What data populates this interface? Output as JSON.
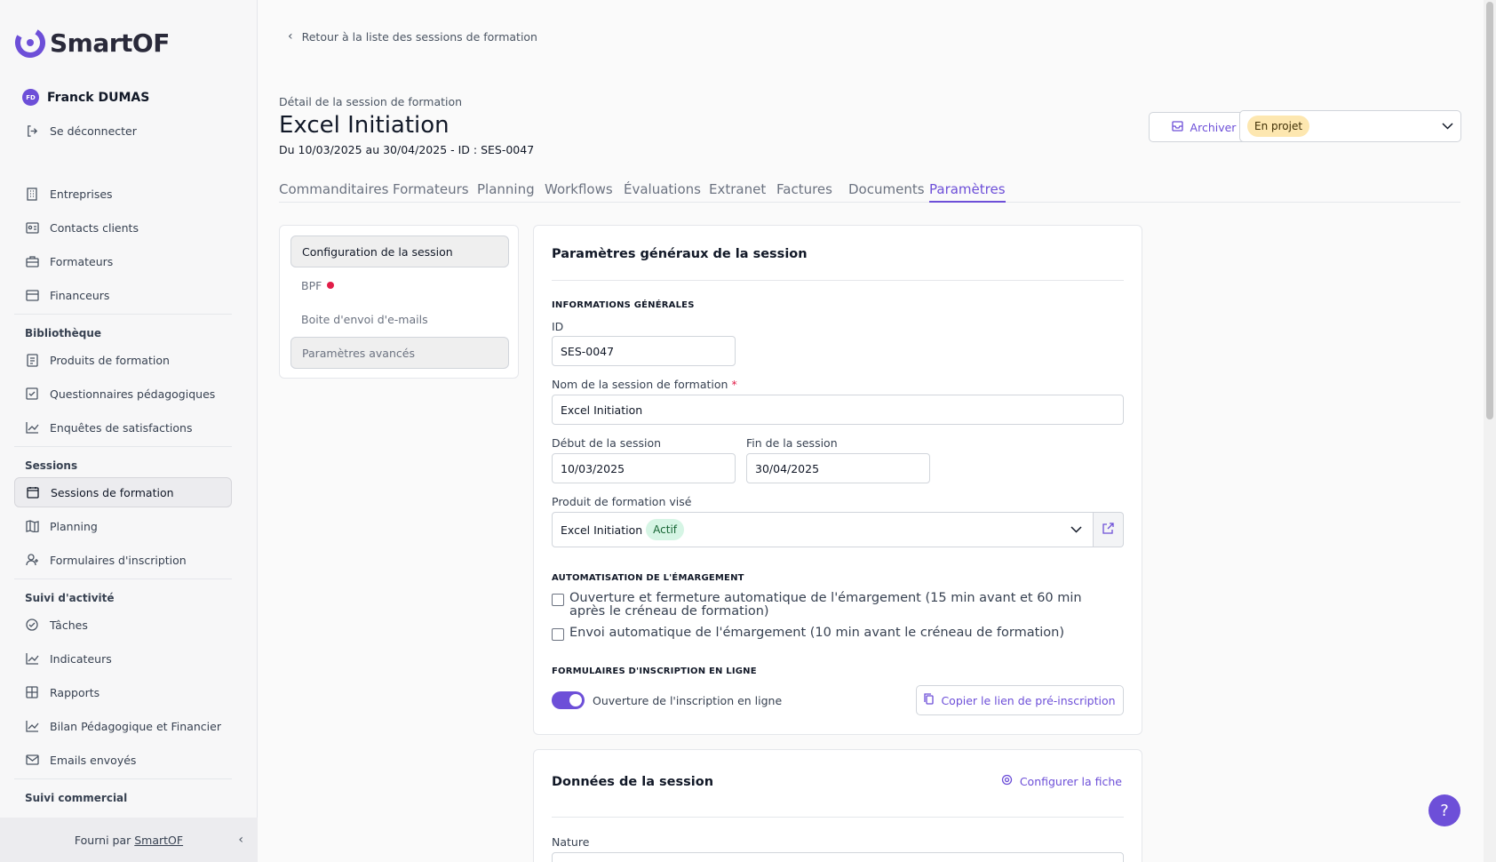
{
  "brand": {
    "name": "SmartOF",
    "accent": "#6d4fd8"
  },
  "user": {
    "initials": "FD",
    "name": "Franck DUMAS",
    "logout_label": "Se déconnecter"
  },
  "nav": {
    "top": [
      {
        "label": "Entreprises",
        "icon": "building-icon"
      },
      {
        "label": "Contacts clients",
        "icon": "contact-card-icon"
      },
      {
        "label": "Formateurs",
        "icon": "briefcase-icon"
      },
      {
        "label": "Financeurs",
        "icon": "wallet-icon"
      }
    ],
    "bibliotheque_title": "Bibliothèque",
    "bibliotheque": [
      {
        "label": "Produits de formation",
        "icon": "book-icon"
      },
      {
        "label": "Questionnaires pédagogiques",
        "icon": "checklist-icon"
      },
      {
        "label": "Enquêtes de satisfactions",
        "icon": "chart-line-icon"
      }
    ],
    "sessions_title": "Sessions",
    "sessions": [
      {
        "label": "Sessions de formation",
        "icon": "calendar-icon"
      },
      {
        "label": "Planning",
        "icon": "map-icon"
      },
      {
        "label": "Formulaires d'inscription",
        "icon": "user-plus-icon"
      }
    ],
    "suivi_title": "Suivi d'activité",
    "suivi": [
      {
        "label": "Tâches",
        "icon": "check-circle-icon"
      },
      {
        "label": "Indicateurs",
        "icon": "trend-icon"
      },
      {
        "label": "Rapports",
        "icon": "table-icon"
      },
      {
        "label": "Bilan Pédagogique et Financier",
        "icon": "chart-line-icon"
      },
      {
        "label": "Emails envoyés",
        "icon": "mail-icon"
      }
    ],
    "commercial_title": "Suivi commercial"
  },
  "footer": {
    "prefix": "Fourni par",
    "link": "SmartOF"
  },
  "header": {
    "back_label": "Retour à la liste des sessions de formation",
    "pre_title": "Détail de la session de formation",
    "title": "Excel Initiation",
    "subtitle": "Du 10/03/2025 au 30/04/2025 - ID : SES-0047",
    "archive_label": "Archiver",
    "status": "En projet"
  },
  "tabs": [
    "Commanditaires",
    "Formateurs",
    "Planning",
    "Workflows",
    "Évaluations",
    "Extranet",
    "Factures",
    "Documents",
    "Paramètres"
  ],
  "settings_menu": [
    "Configuration de la session",
    "BPF",
    "Boite d'envoi d'e-mails",
    "Paramètres avancés"
  ],
  "card": {
    "title": "Paramètres généraux de la session",
    "info_section": "INFORMATIONS GÉNÉRALES",
    "id_label": "ID",
    "id_value": "SES-0047",
    "name_label": "Nom de la session de formation",
    "name_required": "*",
    "name_value": "Excel Initiation",
    "start_label": "Début de la session",
    "start_value": "10/03/2025",
    "end_label": "Fin de la session",
    "end_value": "30/04/2025",
    "product_label": "Produit de formation visé",
    "product_value": "Excel Initiation",
    "product_badge": "Actif",
    "emargement_section": "AUTOMATISATION DE L'ÉMARGEMENT",
    "check1": "Ouverture et fermeture automatique de l'émargement (15 min avant et 60 min après le créneau de formation)",
    "check2": "Envoi automatique de l'émargement (10 min avant le créneau de formation)",
    "forms_section": "FORMULAIRES D'INSCRIPTION EN LIGNE",
    "toggle_label": "Ouverture de l'inscription en ligne",
    "copy_label": "Copier le lien de pré-inscription"
  },
  "card2": {
    "title": "Données de la session",
    "config_label": "Configurer la fiche",
    "nature_label": "Nature"
  },
  "help": "?"
}
